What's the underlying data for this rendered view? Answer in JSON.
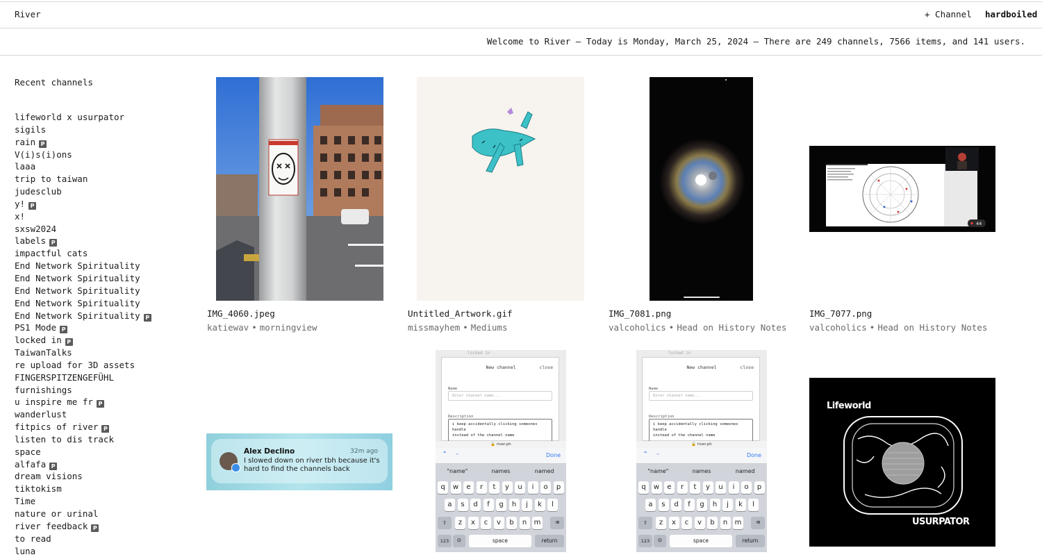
{
  "header": {
    "logo": "River",
    "new_channel": "+ Channel",
    "username": "hardboiled"
  },
  "welcome": "Welcome to River — Today is Monday, March 25, 2024 — There are 249 channels, 7566 items, and 141 users.",
  "sidebar": {
    "title": "Recent channels",
    "badge_label": "P",
    "items": [
      {
        "label": "lifeworld x usurpator",
        "private": false
      },
      {
        "label": "sigils",
        "private": false
      },
      {
        "label": "rain",
        "private": true
      },
      {
        "label": "V(i)s(i)ons",
        "private": false
      },
      {
        "label": "laaa",
        "private": false
      },
      {
        "label": "trip to taiwan",
        "private": false
      },
      {
        "label": "judesclub",
        "private": false
      },
      {
        "label": "y!",
        "private": true
      },
      {
        "label": "x!",
        "private": false
      },
      {
        "label": "sxsw2024",
        "private": false
      },
      {
        "label": "labels",
        "private": true
      },
      {
        "label": "impactful cats",
        "private": false
      },
      {
        "label": "End Network Spirituality",
        "private": false
      },
      {
        "label": "End Network Spirituality",
        "private": false
      },
      {
        "label": "End Network Spirituality",
        "private": false
      },
      {
        "label": "End Network Spirituality",
        "private": false
      },
      {
        "label": "End Network Spirituality",
        "private": true
      },
      {
        "label": "PS1 Mode",
        "private": true
      },
      {
        "label": "locked in",
        "private": true
      },
      {
        "label": "TaiwanTalks",
        "private": false
      },
      {
        "label": "re upload for 3D assets",
        "private": false
      },
      {
        "label": "FINGERSPITZENGEFÜHL",
        "private": false
      },
      {
        "label": "furnishings",
        "private": false
      },
      {
        "label": "u inspire me fr",
        "private": true
      },
      {
        "label": "wanderlust",
        "private": false
      },
      {
        "label": "fitpics of river",
        "private": true
      },
      {
        "label": "listen to dis track",
        "private": false
      },
      {
        "label": "space",
        "private": false
      },
      {
        "label": "alfafa",
        "private": true
      },
      {
        "label": "dream visions",
        "private": false
      },
      {
        "label": "tiktokism",
        "private": false
      },
      {
        "label": "Time",
        "private": false
      },
      {
        "label": "nature or urinal",
        "private": false
      },
      {
        "label": "river feedback",
        "private": true
      },
      {
        "label": "to read",
        "private": false
      },
      {
        "label": "luna",
        "private": false
      }
    ]
  },
  "grid": {
    "items": [
      {
        "filename": "IMG_4060.jpeg",
        "user": "katiewav",
        "channel": "morningview"
      },
      {
        "filename": "Untitled_Artwork.gif",
        "user": "missmayhem",
        "channel": "Mediums"
      },
      {
        "filename": "IMG_7081.png",
        "user": "valcoholics",
        "channel": "Head on History Notes"
      },
      {
        "filename": "IMG_7077.png",
        "user": "valcoholics",
        "channel": "Head on History Notes"
      }
    ],
    "meta_separator": "•"
  },
  "notification": {
    "sender": "Alex Declino",
    "time": "32m ago",
    "message_line1": "I slowed down on river tbh because it's",
    "message_line2": "hard to find the channels back"
  },
  "phone": {
    "top_label": "locked in",
    "dialog_title": "New channel",
    "close": "close",
    "name_label": "Name",
    "name_placeholder": "Enter channel name...",
    "description_label": "Description",
    "description_line1": "i keep accidentally clicking someones handle",
    "description_line2": "instead of the channel name",
    "url": "🔒 river.ph",
    "done": "Done",
    "suggestions": [
      "\"name\"",
      "names",
      "named"
    ],
    "row1": [
      "q",
      "w",
      "e",
      "r",
      "t",
      "y",
      "u",
      "i",
      "o",
      "p"
    ],
    "row2": [
      "a",
      "s",
      "d",
      "f",
      "g",
      "h",
      "j",
      "k",
      "l"
    ],
    "row3": [
      "z",
      "x",
      "c",
      "v",
      "b",
      "n",
      "m"
    ],
    "num_key": "123",
    "space": "space",
    "return": "return"
  },
  "poster": {
    "top_text": "Lifeworld",
    "bottom_text": "USURPATOR"
  },
  "screen_share": {
    "count": "44"
  }
}
